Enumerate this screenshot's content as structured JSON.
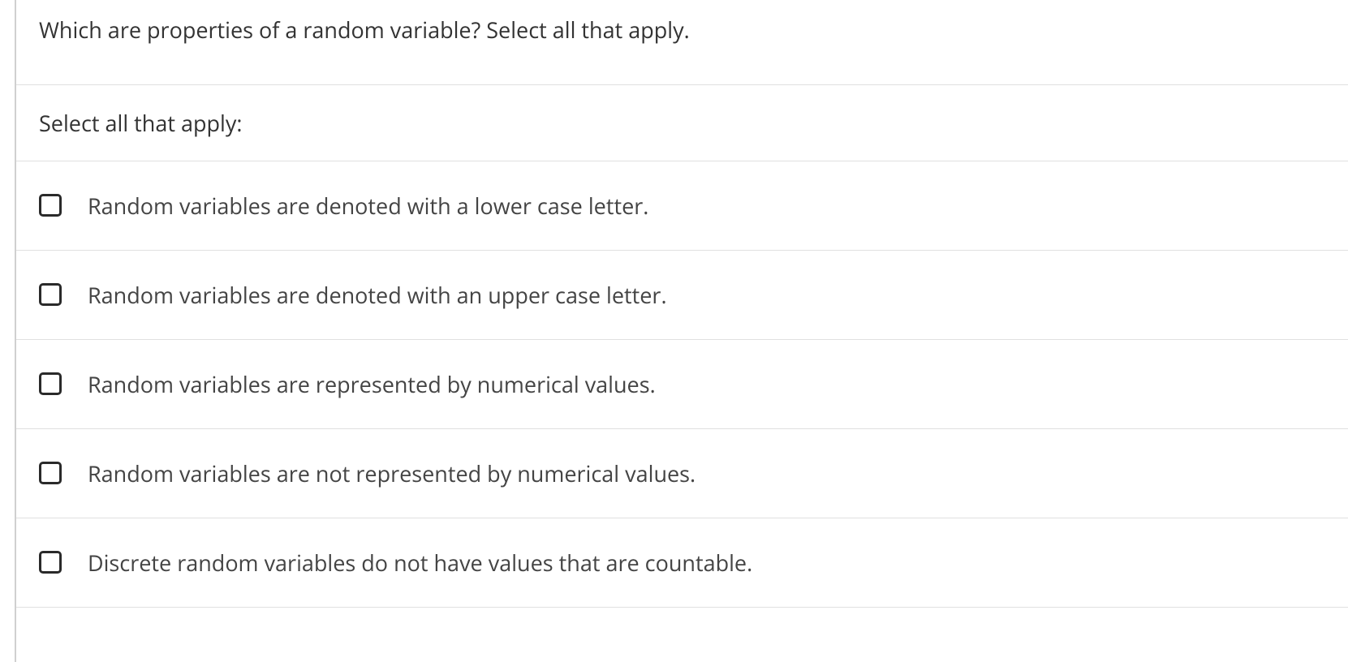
{
  "question": {
    "text": "Which are properties of a random variable? Select all that apply.",
    "instruction": "Select all that apply:",
    "options": [
      {
        "label": "Random variables are denoted with a lower case letter."
      },
      {
        "label": "Random variables are denoted with an upper case letter."
      },
      {
        "label": "Random variables are represented by numerical values."
      },
      {
        "label": "Random variables are not represented by numerical values."
      },
      {
        "label": "Discrete random variables do not have values that are countable."
      }
    ]
  }
}
